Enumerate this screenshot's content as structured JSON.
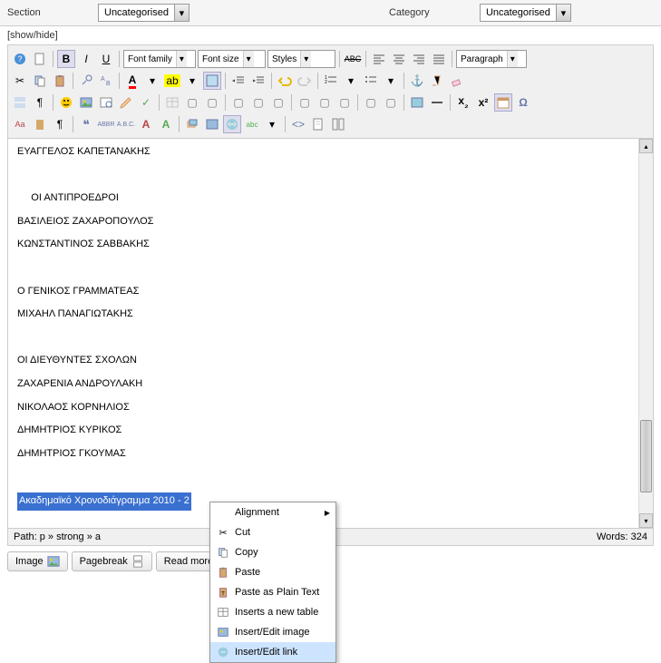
{
  "topbar": {
    "section_label": "Section",
    "section_value": "Uncategorised",
    "category_label": "Category",
    "category_value": "Uncategorised"
  },
  "showhide": "[show/hide]",
  "toolbar": {
    "font_family": "Font family",
    "font_size": "Font size",
    "styles": "Styles",
    "paragraph": "Paragraph"
  },
  "content": {
    "lines": [
      "ΕΥΑΓΓΕΛΟΣ ΚΑΠΕΤΑΝΑΚΗΣ",
      "",
      "     ΟΙ ΑΝΤΙΠΡΟΕΔΡΟΙ",
      "ΒΑΣΙΛΕΙΟΣ ΖΑΧΑΡΟΠΟΥΛΟΣ",
      "ΚΩΝΣΤΑΝΤΙΝΟΣ ΣΑΒΒΑΚΗΣ",
      "",
      "Ο ΓΕΝΙΚΟΣ ΓΡΑΜΜΑΤΕΑΣ",
      "ΜΙΧΑΗΛ ΠΑΝΑΓΙΩΤΑΚΗΣ",
      "",
      "ΟΙ ΔΙΕΥΘΥΝΤΕΣ ΣΧΟΛΩΝ",
      "ΖΑΧΑΡΕΝΙΑ ΑΝΔΡΟΥΛΑΚΗ",
      "ΝΙΚΟΛΑΟΣ ΚΟΡΝΗΛΙΟΣ",
      "ΔΗΜΗΤΡΙΟΣ ΚΥΡΙΚΟΣ",
      "ΔΗΜΗΤΡΙΟΣ ΓΚΟΥΜΑΣ"
    ],
    "selected": "Ακαδημαϊκό Χρονοδιάγραμμα 2010 - 2"
  },
  "statusbar": {
    "path": "Path: p » strong » a",
    "words": "Words: 324"
  },
  "buttons": {
    "image": "Image",
    "pagebreak": "Pagebreak",
    "readmore": "Read more"
  },
  "contextmenu": {
    "alignment": "Alignment",
    "cut": "Cut",
    "copy": "Copy",
    "paste": "Paste",
    "paste_plain": "Paste as Plain Text",
    "insert_table": "Inserts a new table",
    "insert_image": "Insert/Edit image",
    "insert_link": "Insert/Edit link"
  }
}
